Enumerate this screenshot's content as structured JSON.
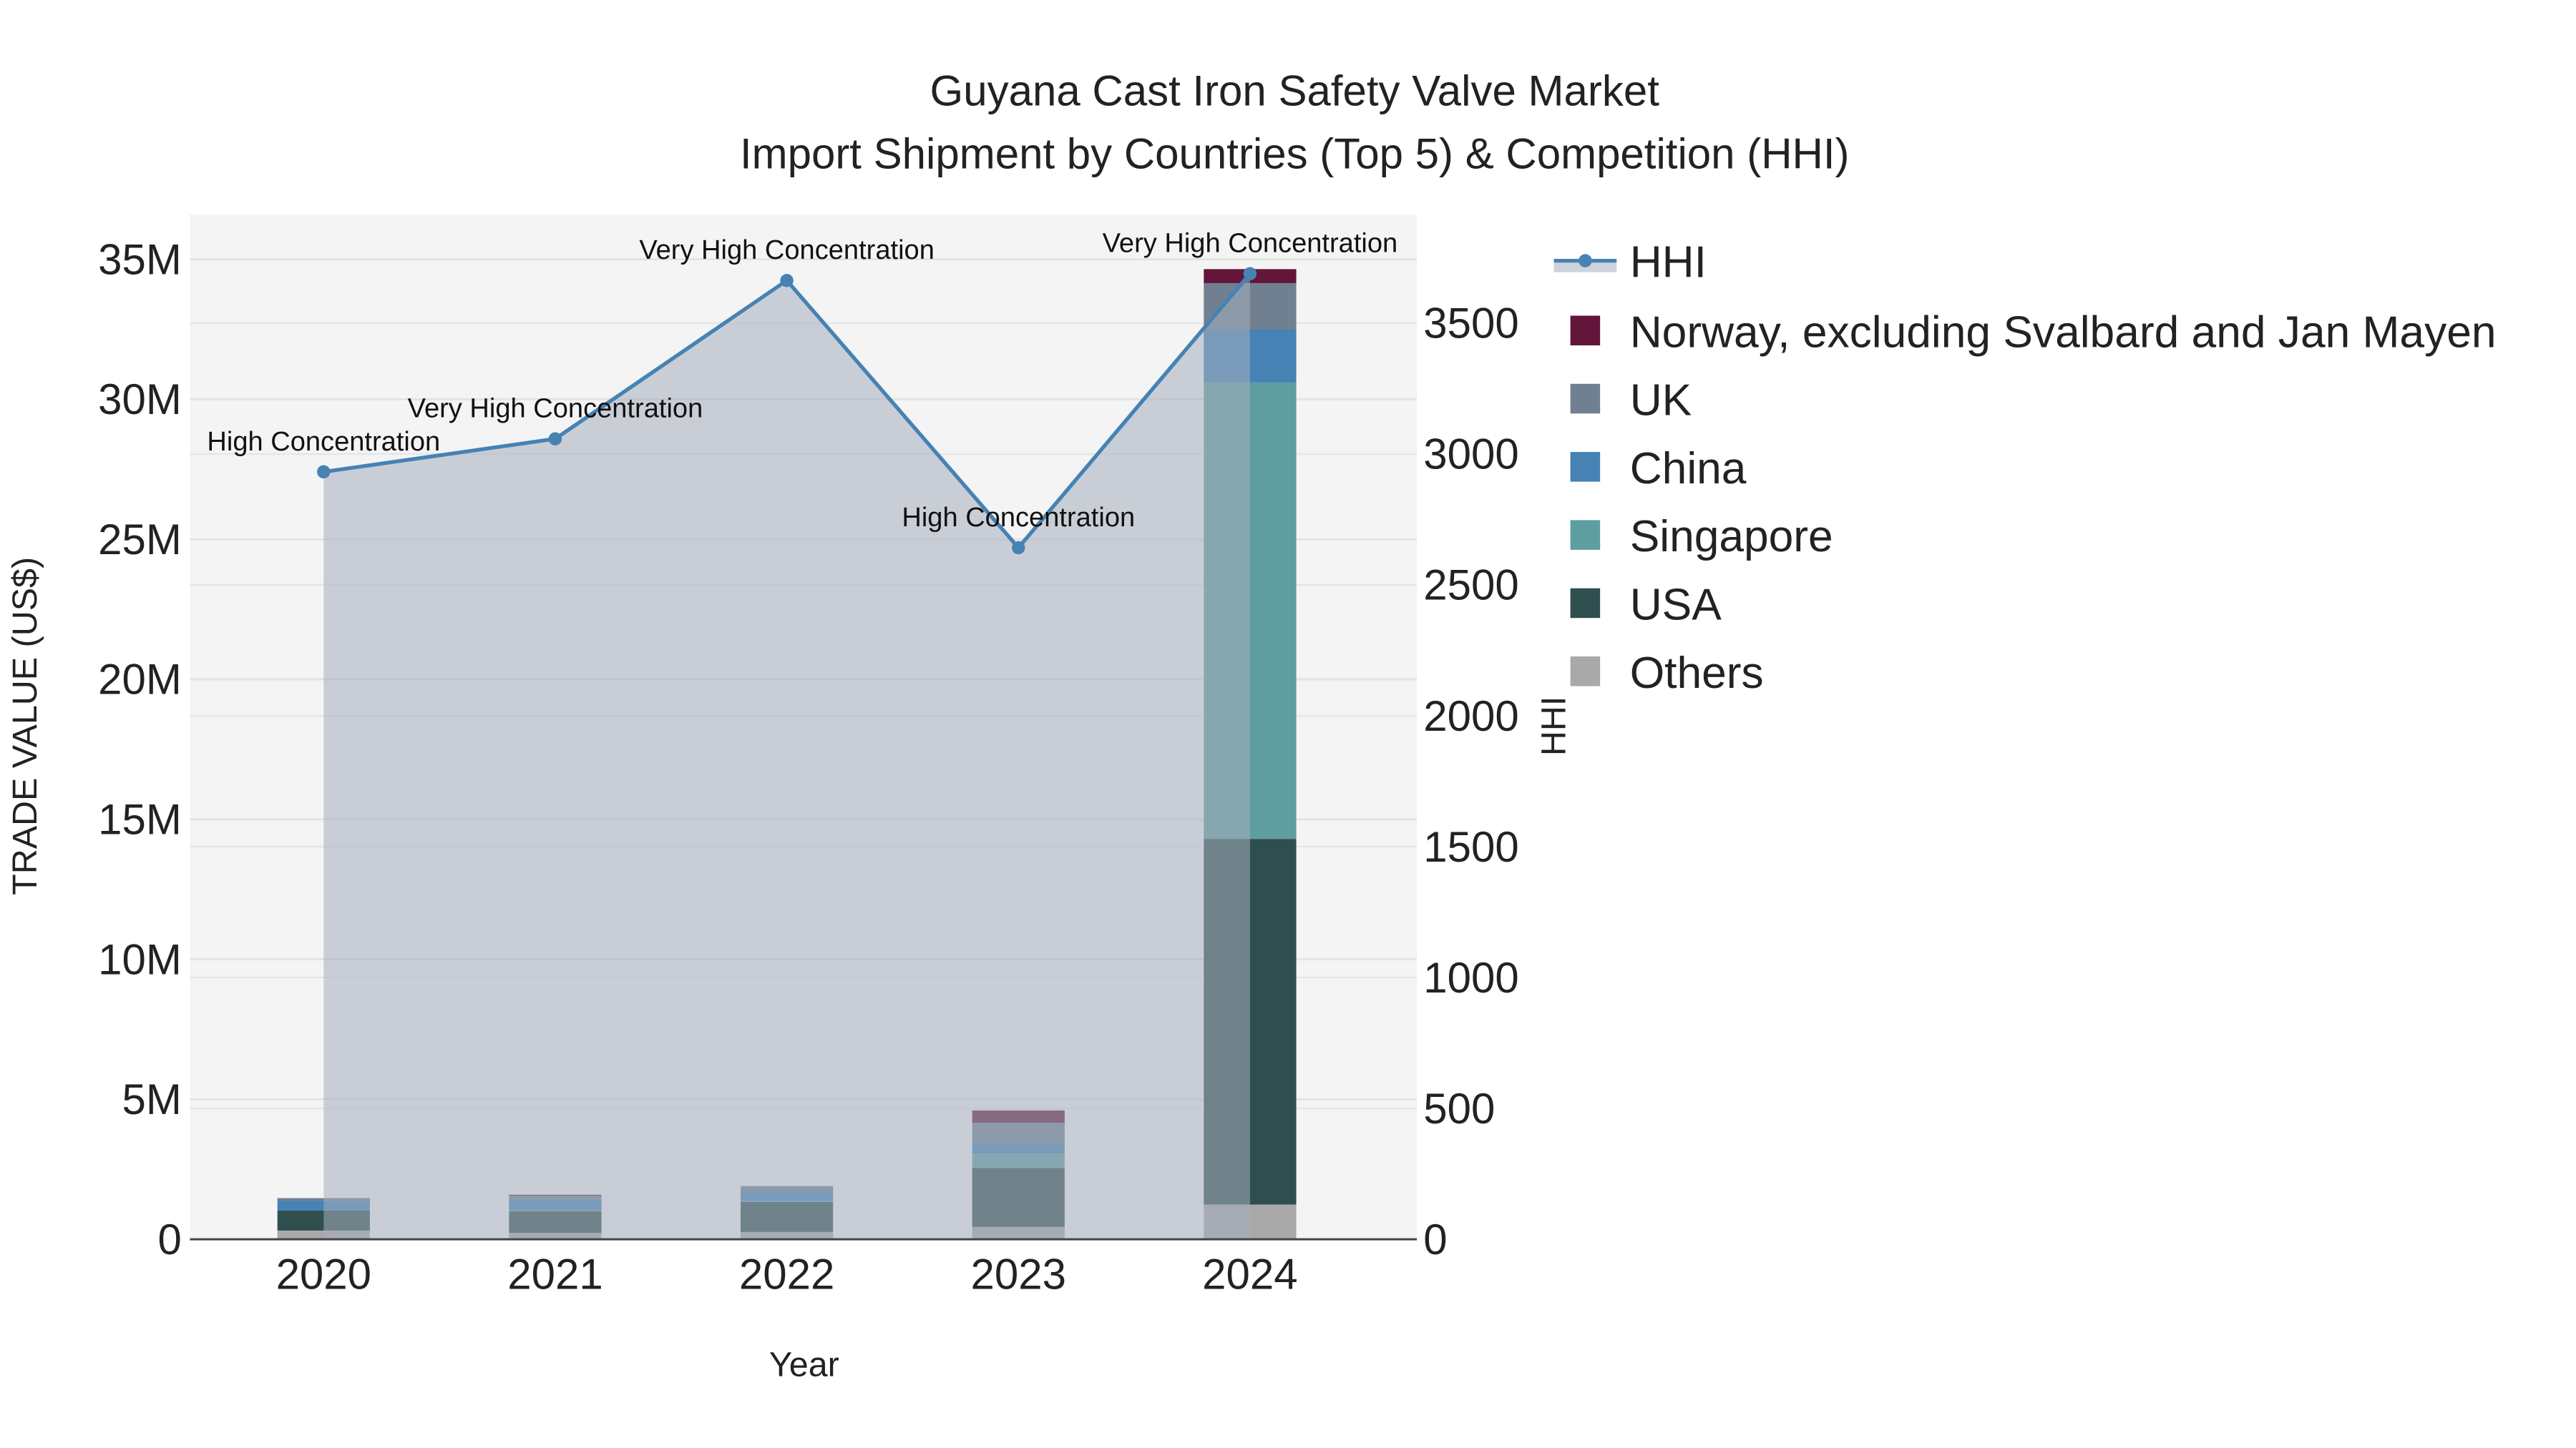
{
  "chart_data": {
    "type": "bar",
    "title_line1": "Guyana Cast Iron Safety Valve Market",
    "title_line2": "Import Shipment by Countries (Top 5) & Competition (HHI)",
    "xlabel": "Year",
    "ylabel": "TRADE VALUE (US$)",
    "y2label": "HHI",
    "categories": [
      "2020",
      "2021",
      "2022",
      "2023",
      "2024"
    ],
    "ylim": [
      0,
      36600000
    ],
    "y2lim": [
      0,
      3915
    ],
    "yticks": [
      0,
      5000000,
      10000000,
      15000000,
      20000000,
      25000000,
      30000000,
      35000000
    ],
    "ytick_labels": [
      "0",
      "5M",
      "10M",
      "15M",
      "20M",
      "25M",
      "30M",
      "35M"
    ],
    "y2ticks": [
      0,
      500,
      1000,
      1500,
      2000,
      2500,
      3000,
      3500
    ],
    "y2tick_labels": [
      "0",
      "500",
      "1000",
      "1500",
      "2000",
      "2500",
      "3000",
      "3500"
    ],
    "grid": true,
    "legend_position": "right",
    "series": [
      {
        "name": "Others",
        "color": "#a9a9a9",
        "values": [
          310000,
          230000,
          260000,
          440000,
          1240000
        ]
      },
      {
        "name": "USA",
        "color": "#2f4f4f",
        "values": [
          720000,
          770000,
          1080000,
          2110000,
          13060000
        ]
      },
      {
        "name": "Singapore",
        "color": "#5f9ea0",
        "values": [
          0,
          30000,
          20000,
          510000,
          16300000
        ]
      },
      {
        "name": "China",
        "color": "#4682b4",
        "values": [
          340000,
          380000,
          340000,
          380000,
          1900000
        ]
      },
      {
        "name": "UK",
        "color": "#708090",
        "values": [
          100000,
          160000,
          200000,
          720000,
          1650000
        ]
      },
      {
        "name": "Norway, excluding Svalbard and Jan Mayen",
        "color": "#63163a",
        "values": [
          0,
          20000,
          0,
          440000,
          500000
        ]
      }
    ],
    "legend_order": [
      "HHI",
      "Norway, excluding Svalbard and Jan Mayen",
      "UK",
      "China",
      "Singapore",
      "USA",
      "Others"
    ],
    "hhi": {
      "name": "HHI",
      "color": "#4682b4",
      "values": [
        2932,
        3058,
        3663,
        2642,
        3689
      ],
      "annotations": [
        "High Concentration",
        "Very High Concentration",
        "Very High Concentration",
        "High Concentration",
        "Very High Concentration"
      ]
    }
  }
}
